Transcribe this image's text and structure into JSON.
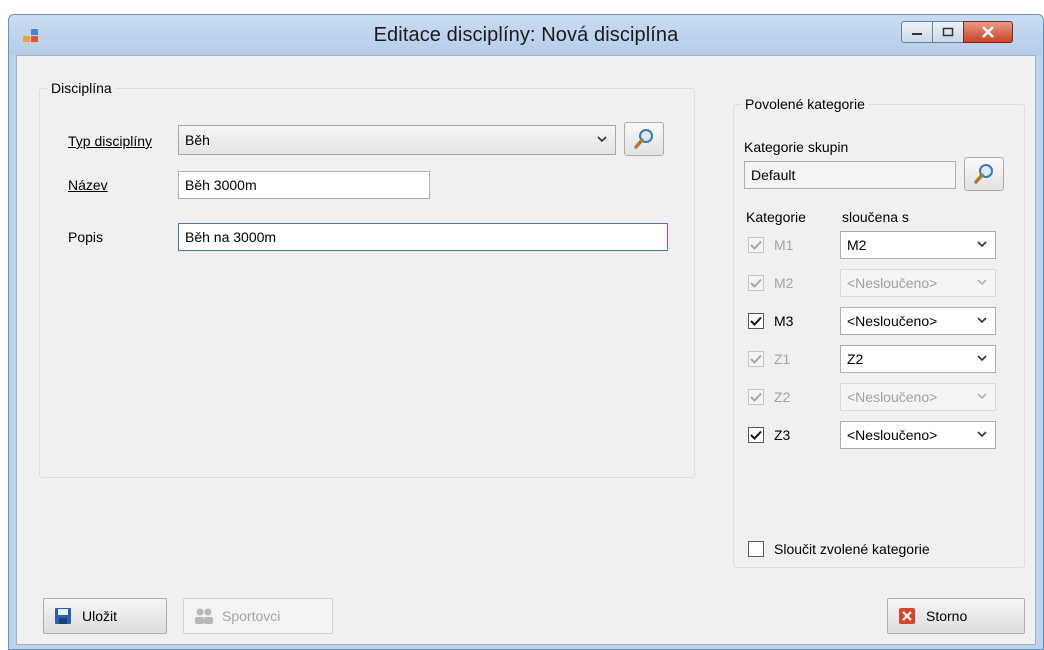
{
  "window": {
    "title": "Editace disciplíny: Nová disciplína"
  },
  "disciplina_group": {
    "title": "Disciplína",
    "typ_label": "Typ disciplíny",
    "typ_value": "Běh",
    "nazev_label": "Název",
    "nazev_value": "Běh 3000m",
    "popis_label": "Popis",
    "popis_value": "Běh na 3000m"
  },
  "kategorie_group": {
    "title": "Povolené kategorie",
    "skupin_label": "Kategorie skupin",
    "skupin_value": "Default",
    "col_kategorie": "Kategorie",
    "col_sloucena": "sloučena s",
    "rows": [
      {
        "name": "M1",
        "checked": true,
        "enabled": false,
        "merge": "M2",
        "merge_enabled": true
      },
      {
        "name": "M2",
        "checked": true,
        "enabled": false,
        "merge": "<Nesloučeno>",
        "merge_enabled": false
      },
      {
        "name": "M3",
        "checked": true,
        "enabled": true,
        "merge": "<Nesloučeno>",
        "merge_enabled": true
      },
      {
        "name": "Z1",
        "checked": true,
        "enabled": false,
        "merge": "Z2",
        "merge_enabled": true
      },
      {
        "name": "Z2",
        "checked": true,
        "enabled": false,
        "merge": "<Nesloučeno>",
        "merge_enabled": false
      },
      {
        "name": "Z3",
        "checked": true,
        "enabled": true,
        "merge": "<Nesloučeno>",
        "merge_enabled": true
      }
    ],
    "merge_selected_label": "Sloučit zvolené kategorie",
    "merge_selected_checked": false
  },
  "buttons": {
    "save": "Uložit",
    "athletes": "Sportovci",
    "cancel": "Storno"
  },
  "icons": {
    "app": "app-icon",
    "search": "magnifier-icon",
    "save": "floppy-disk-icon",
    "athletes": "people-icon",
    "cancel": "red-x-icon"
  },
  "colors": {
    "titlebar": "#bcd3ec",
    "client_bg": "#f0f0f0",
    "close_button": "#c9442a"
  }
}
